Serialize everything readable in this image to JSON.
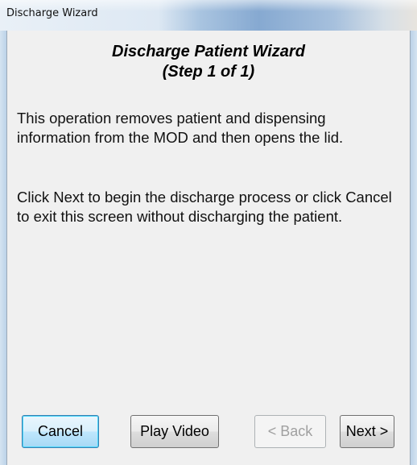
{
  "window": {
    "title": "Discharge Wizard"
  },
  "wizard": {
    "heading_line1": "Discharge Patient Wizard",
    "heading_line2": "(Step 1 of 1)",
    "paragraph1": "This operation removes patient and dispensing information from the MOD and then opens the lid.",
    "paragraph2": "Click Next to begin the discharge process or click Cancel to exit this screen without discharging the patient."
  },
  "buttons": {
    "cancel": "Cancel",
    "play_video": "Play Video",
    "back": "< Back",
    "next": "Next >"
  },
  "colors": {
    "focused_button_border": "#3c7fb1",
    "disabled_text": "#a0a0a0",
    "client_background": "#f0f0f0"
  }
}
